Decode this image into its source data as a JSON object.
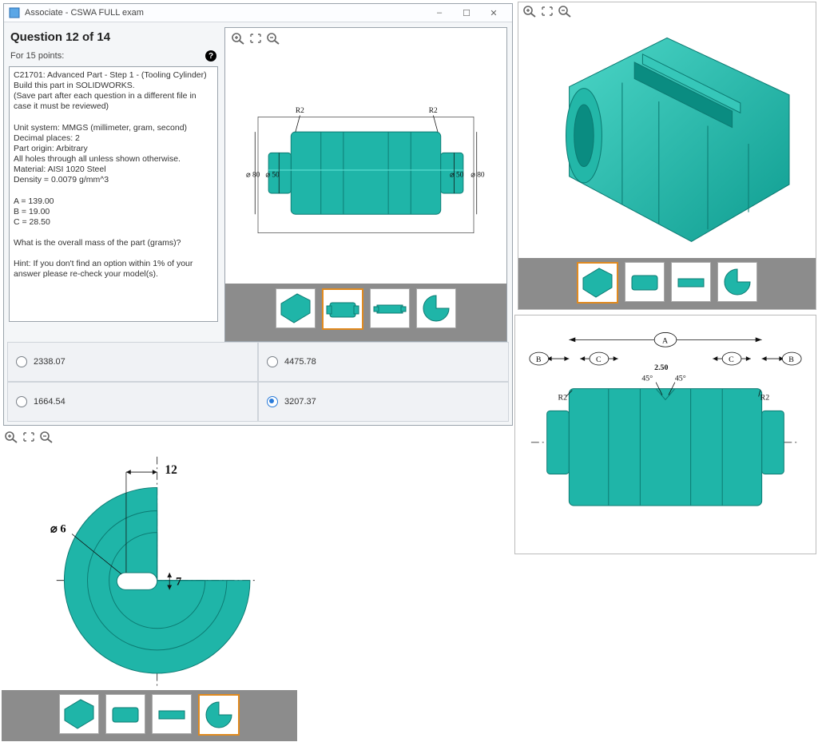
{
  "window": {
    "title": "Associate - CSWA FULL exam",
    "min_label": "–",
    "max_label": "☐",
    "close_label": "✕"
  },
  "question": {
    "heading": "Question 12 of 14",
    "points_line": "For 15 points:",
    "body": "C21701:  Advanced Part - Step 1 - (Tooling Cylinder)\nBuild this part in SOLIDWORKS.\n(Save part after each question in a different file in case it must be reviewed)\n\nUnit system: MMGS (millimeter, gram, second)\nDecimal places: 2\nPart origin: Arbitrary\nAll holes through all unless shown otherwise.\nMaterial: AISI 1020 Steel\nDensity = 0.0079 g/mm^3\n\nA = 139.00\nB = 19.00\nC = 28.50\n\nWhat is the overall mass of the part (grams)?\n\nHint: If you don't find an option within 1% of your answer please re-check your model(s)."
  },
  "answers": [
    {
      "value": "2338.07",
      "selected": false
    },
    {
      "value": "4475.78",
      "selected": false
    },
    {
      "value": "1664.54",
      "selected": false
    },
    {
      "value": "3207.37",
      "selected": true
    }
  ],
  "drawing_front": {
    "r2_left": "R2",
    "r2_right": "R2",
    "d80_left": "⌀ 80",
    "d50_left": "⌀ 50",
    "d50_right": "⌀ 50",
    "d80_right": "⌀ 80"
  },
  "drawing_top_dims": {
    "A": "A",
    "B": "B",
    "C": "C",
    "chamfer": "2.50",
    "ang_l": "45°",
    "ang_r": "45°",
    "r2_left": "R2",
    "r2_right": "R2"
  },
  "drawing_section": {
    "dim12": "12",
    "dim7": "7",
    "dim6": "⌀ 6"
  },
  "thumb_names": [
    "iso-view",
    "front-view",
    "top-view",
    "section-view"
  ],
  "colors": {
    "part": "#1fb5a8",
    "part_dark": "#0c7a72",
    "sel_border": "#e08a1f"
  }
}
